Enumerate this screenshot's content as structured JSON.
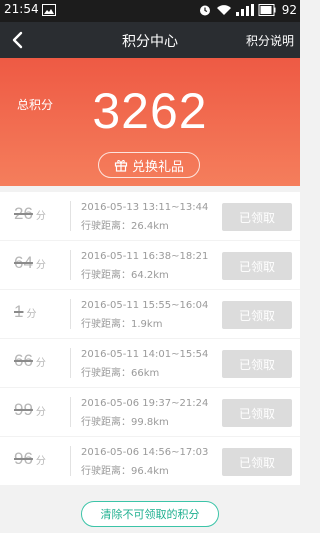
{
  "status_bar": {
    "time": "21:54",
    "battery": "92"
  },
  "nav": {
    "title": "积分中心",
    "help_label": "积分说明"
  },
  "summary": {
    "total_label": "总积分",
    "total_points": "3262",
    "redeem_label": "兑换礼品"
  },
  "records": [
    {
      "points": "26",
      "unit": "分",
      "time": "2016-05-13 13:11~13:44",
      "distance_label": "行驶距离：",
      "distance": "26.4km",
      "status": "已领取"
    },
    {
      "points": "64",
      "unit": "分",
      "time": "2016-05-11 16:38~18:21",
      "distance_label": "行驶距离：",
      "distance": "64.2km",
      "status": "已领取"
    },
    {
      "points": "1",
      "unit": "分",
      "time": "2016-05-11 15:55~16:04",
      "distance_label": "行驶距离：",
      "distance": "1.9km",
      "status": "已领取"
    },
    {
      "points": "66",
      "unit": "分",
      "time": "2016-05-11 14:01~15:54",
      "distance_label": "行驶距离：",
      "distance": "66km",
      "status": "已领取"
    },
    {
      "points": "99",
      "unit": "分",
      "time": "2016-05-06 19:37~21:24",
      "distance_label": "行驶距离：",
      "distance": "99.8km",
      "status": "已领取"
    },
    {
      "points": "96",
      "unit": "分",
      "time": "2016-05-06 14:56~17:03",
      "distance_label": "行驶距离：",
      "distance": "96.4km",
      "status": "已领取"
    }
  ],
  "footer": {
    "clear_label": "清除不可领取的积分"
  },
  "colors": {
    "hero_top": "#ee5a44",
    "hero_bottom": "#f57e5c",
    "accent_green": "#20b090",
    "claimed_bg": "#dcdcdc"
  }
}
